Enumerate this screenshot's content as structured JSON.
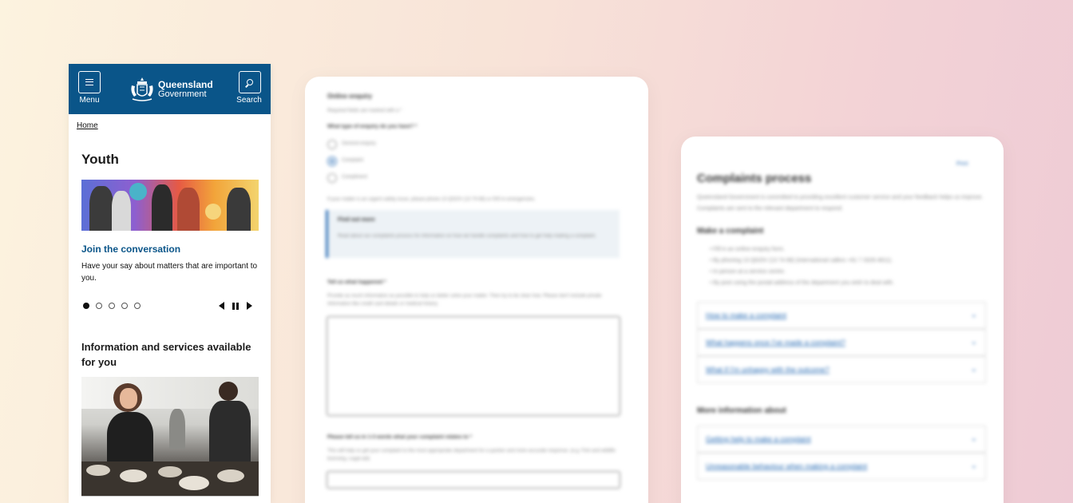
{
  "phone": {
    "menu_label": "Menu",
    "search_label": "Search",
    "logo_line1": "Queensland",
    "logo_line2": "Government",
    "breadcrumb": "Home",
    "page_title": "Youth",
    "carousel": {
      "title": "Join the conversation",
      "text": "Have your say about matters that are important to you.",
      "slide_count": 5,
      "active_index": 0
    },
    "section_title": "Information and services available for you"
  },
  "form": {
    "heading": "Online enquiry",
    "required_note": "Required fields are marked with a *",
    "question": "What type of enquiry do you have? *",
    "options": [
      "General enquiry",
      "Complaint",
      "Compliment"
    ],
    "selected_option": "Complaint",
    "safety_note": "If your matter is an urgent safety issue, please phone 13 QGOV (13 74 68) or 000 in emergencies.",
    "safety_link": "13 74 68",
    "info_title": "Find out more",
    "info_text": "Read about our complaints process for information on how we handle complaints and how to get help making a complaint.",
    "what_happened_label": "Tell us what happened *",
    "what_happened_hint": "Provide as much information as possible to help us better solve your matter. Then try to be clear how. Please don't include private information like credit card details or medical history.",
    "relates_label": "Please tell us in 1-3 words what your complaint relates to *",
    "relates_hint": "This will help us get your complaint to the most appropriate department for a quicker and more accurate response. (e.g. Fish and wildlife licensing, Legal aid)"
  },
  "process": {
    "print_label": "Print",
    "heading": "Complaints process",
    "intro": "Queensland Government is committed to providing excellent customer service and your feedback helps us improve. Complaints are sent to the relevant department to respond.",
    "make_heading": "Make a complaint",
    "bullets": [
      "Fill in an online enquiry form.",
      "By phoning 13 QGOV (13 74 68) (international callers +61 7 3328 4811).",
      "In person at a service centre.",
      "By post using the postal address of the department you wish to deal with."
    ],
    "accordions": [
      "How to make a complaint",
      "What happens once I've made a complaint?",
      "What if I'm unhappy with the outcome?"
    ],
    "more_heading": "More information about",
    "more_accordions": [
      "Getting help to make a complaint",
      "Unreasonable behaviour when making a complaint"
    ]
  }
}
